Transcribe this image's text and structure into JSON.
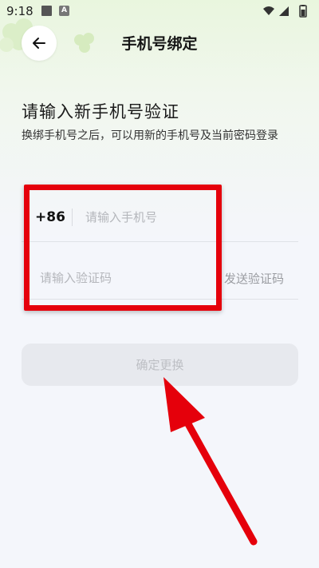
{
  "status_bar": {
    "time": "9:18",
    "notification_badge": "A",
    "icons": [
      "wifi-icon",
      "signal-icon",
      "battery-icon"
    ]
  },
  "header": {
    "back_icon": "arrow-left-icon",
    "title": "手机号绑定"
  },
  "main": {
    "heading": "请输入新手机号验证",
    "subtitle": "换绑手机号之后，可以用新的手机号及当前密码登录",
    "phone": {
      "country_code": "+86",
      "value": "",
      "placeholder": "请输入手机号"
    },
    "code": {
      "value": "",
      "placeholder": "请输入验证码",
      "send_label": "发送验证码"
    },
    "confirm_label": "确定更换"
  },
  "annotation": {
    "highlight_color": "#e5000b",
    "arrow_color": "#e5000b"
  },
  "colors": {
    "accent_green": "#e9f6de",
    "button_disabled_bg": "#e7e9ee",
    "button_disabled_text": "#bdbfc4"
  }
}
